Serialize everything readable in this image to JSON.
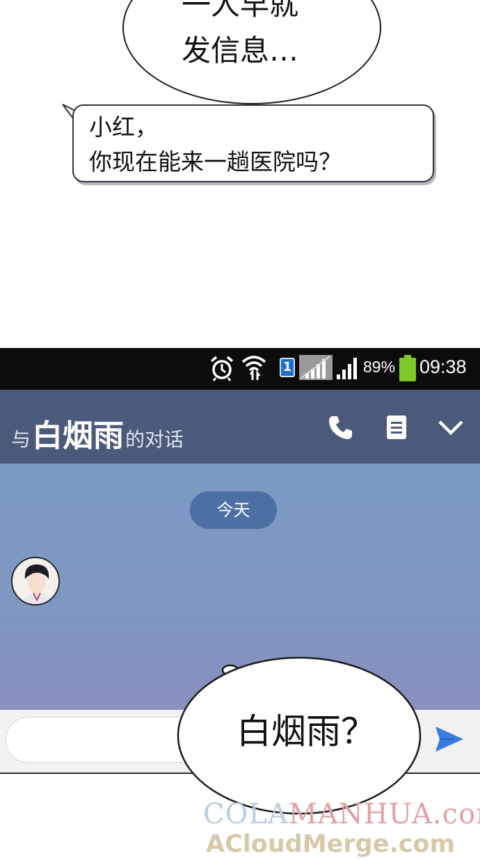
{
  "narration": {
    "line1": "一人早就",
    "line2": "发信息…"
  },
  "status_bar": {
    "sim_slot": "1",
    "battery_percent": "89%",
    "battery_level": 0.89,
    "time": "09:38",
    "icons": [
      "alarm-icon",
      "wifi-icon",
      "sim-icon",
      "signal-icon",
      "signal-icon",
      "battery-icon"
    ]
  },
  "header": {
    "prefix": "与",
    "contact_name": "白烟雨",
    "suffix": "的对话",
    "icons": [
      "phone-icon",
      "menu-icon",
      "chevron-down-icon"
    ]
  },
  "chat": {
    "date_label": "今天",
    "message": {
      "line1": "小红，",
      "line2": "你现在能来一趟医院吗？"
    }
  },
  "input": {
    "value": "",
    "icons": [
      "emoji-icon",
      "send-icon"
    ]
  },
  "thought": {
    "text": "白烟雨？"
  },
  "watermark": {
    "line1_a": "COLA",
    "line1_b": "MANHUA.com",
    "line2": "ACloudMerge.com"
  },
  "colors": {
    "status_bar_bg": "#0c0c0c",
    "header_bg": "#4b5a7a",
    "chat_bg": "#7a9bc4",
    "date_pill": "#4c6fa4",
    "battery": "#7fc82a",
    "send_icon": "#3a7be0"
  }
}
